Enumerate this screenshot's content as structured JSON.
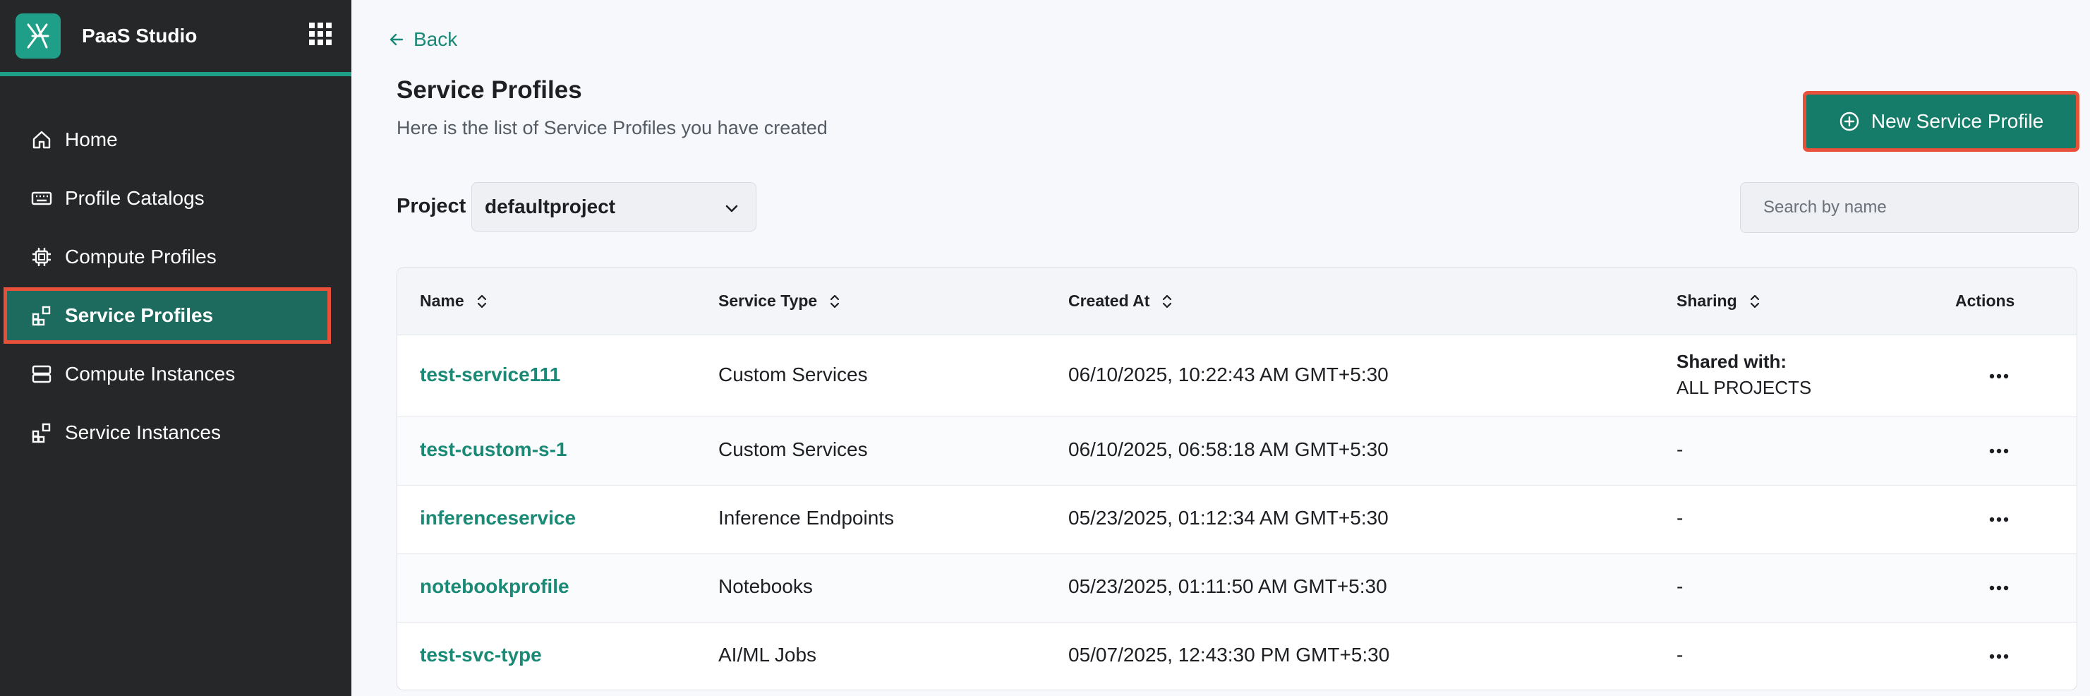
{
  "app": {
    "title": "PaaS Studio"
  },
  "sidebar": {
    "items": [
      {
        "label": "Home",
        "icon": "home-icon"
      },
      {
        "label": "Profile Catalogs",
        "icon": "catalog-icon"
      },
      {
        "label": "Compute Profiles",
        "icon": "chip-icon"
      },
      {
        "label": "Service Profiles",
        "icon": "service-icon",
        "active": true
      },
      {
        "label": "Compute Instances",
        "icon": "server-icon"
      },
      {
        "label": "Service Instances",
        "icon": "service-icon"
      }
    ]
  },
  "header": {
    "back_label": "Back",
    "title": "Service Profiles",
    "subtitle": "Here is the list of Service Profiles you have created",
    "new_button_label": "New Service Profile"
  },
  "filters": {
    "project_label": "Project",
    "project_value": "defaultproject",
    "search_placeholder": "Search by name"
  },
  "table": {
    "columns": [
      "Name",
      "Service Type",
      "Created At",
      "Sharing",
      "Actions"
    ],
    "rows": [
      {
        "name": "test-service111",
        "type": "Custom Services",
        "created": "06/10/2025, 10:22:43 AM GMT+5:30",
        "sharing_title": "Shared with:",
        "sharing": "ALL PROJECTS"
      },
      {
        "name": "test-custom-s-1",
        "type": "Custom Services",
        "created": "06/10/2025, 06:58:18 AM GMT+5:30",
        "sharing_title": "",
        "sharing": "-"
      },
      {
        "name": "inferenceservice",
        "type": "Inference Endpoints",
        "created": "05/23/2025, 01:12:34 AM GMT+5:30",
        "sharing_title": "",
        "sharing": "-"
      },
      {
        "name": "notebookprofile",
        "type": "Notebooks",
        "created": "05/23/2025, 01:11:50 AM GMT+5:30",
        "sharing_title": "",
        "sharing": "-"
      },
      {
        "name": "test-svc-type",
        "type": "AI/ML Jobs",
        "created": "05/07/2025, 12:43:30 PM GMT+5:30",
        "sharing_title": "",
        "sharing": "-"
      }
    ]
  },
  "colors": {
    "accent": "#1a8a76",
    "sidebar_bg": "#262728",
    "highlight": "#e8503a"
  }
}
